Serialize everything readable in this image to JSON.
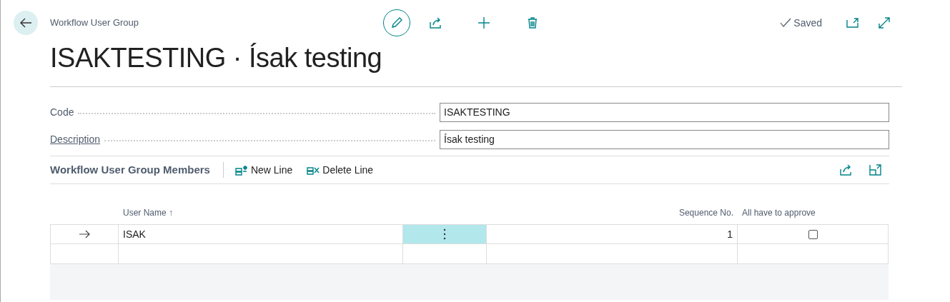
{
  "page": {
    "caption": "Workflow User Group",
    "title": "ISAKTESTING · Ísak testing",
    "status": "Saved"
  },
  "fields": [
    {
      "label": "Code",
      "value": "ISAKTESTING",
      "link": false
    },
    {
      "label": "Description",
      "value": "Ísak testing",
      "link": true
    }
  ],
  "part": {
    "title": "Workflow User Group Members",
    "actions": [
      {
        "kind": "new",
        "label": "New Line"
      },
      {
        "kind": "delete",
        "label": "Delete Line"
      }
    ]
  },
  "table": {
    "columns": [
      {
        "label": "User Name",
        "sort_mark": "↑"
      },
      {
        "label": "Sequence No."
      },
      {
        "label": "All have to approve"
      }
    ],
    "rows": [
      {
        "selected": true,
        "user_name": "ISAK",
        "sequence_no": "1",
        "all_have_to_approve": false
      }
    ]
  }
}
